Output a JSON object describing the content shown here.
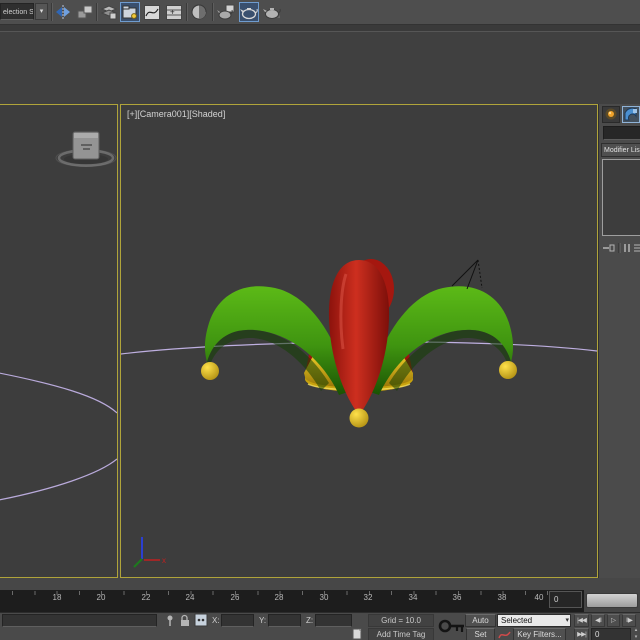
{
  "toolbar": {
    "selection_set_value": "election Se",
    "dropdown_arrow": "▾",
    "icons": [
      "mirror-icon",
      "align-icon",
      "manage-layers-icon",
      "scene-explorer-icon",
      "curve-editor-icon",
      "schematic-view-icon",
      "material-editor-icon",
      "render-setup-icon",
      "rendered-frame-window-icon",
      "render-production-icon"
    ]
  },
  "viewport": {
    "label": "[+][Camera001][Shaded]"
  },
  "command_panel": {
    "modifier_list_label": "Modifier Lis"
  },
  "timeline": {
    "ticks": [
      "18",
      "20",
      "22",
      "24",
      "26",
      "28",
      "30",
      "32",
      "34",
      "36",
      "38",
      "40"
    ],
    "end_frame_value": "0"
  },
  "status_bar": {
    "x_label": "X:",
    "y_label": "Y:",
    "z_label": "Z:",
    "grid_label": "Grid = 10.0",
    "add_time_tag_label": "Add Time Tag",
    "auto_key_label": "Auto Key",
    "set_key_label": "Set Key",
    "selected_filter_value": "Selected",
    "selected_dd_arrow": "▾",
    "key_filters_label": "Key Filters...",
    "frame_value": "0",
    "spinner_up": "▴",
    "spinner_down": "▾",
    "playback": {
      "goto_start": "|◀◀",
      "prev_frame": "◀‖",
      "play": "▷",
      "next_frame": "‖▶",
      "goto_end": "▶▶|"
    }
  },
  "colors": {
    "active_viewport_border": "#b0a43a",
    "toolbar_highlight_blue": "#6f9ccf",
    "hat_green": "#4aa411",
    "hat_red": "#bd1e14",
    "hat_yellow": "#edc91f",
    "spline_lavender": "#beafe0",
    "viewport_background": "#3d3d3d"
  }
}
